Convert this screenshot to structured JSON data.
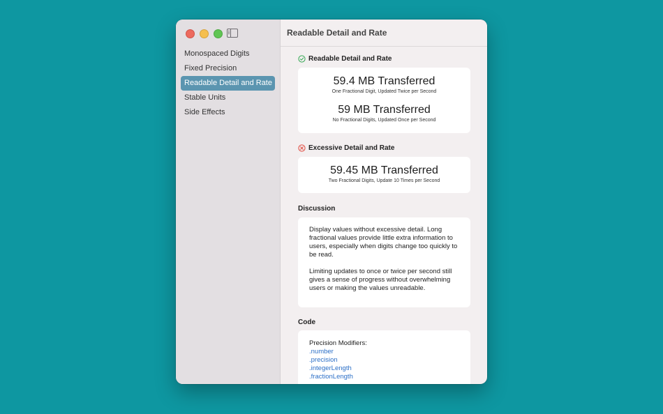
{
  "window": {
    "title": "Readable Detail and Rate"
  },
  "sidebar": {
    "items": [
      {
        "label": "Monospaced Digits"
      },
      {
        "label": "Fixed Precision"
      },
      {
        "label": "Readable Detail and Rate",
        "selected": true
      },
      {
        "label": "Stable Units"
      },
      {
        "label": "Side Effects"
      }
    ]
  },
  "readable": {
    "heading": "Readable Detail and Rate",
    "icon": "checkmark-circle-icon",
    "icon_color": "#34a853",
    "rows": [
      {
        "value": "59.4 MB Transferred",
        "caption": "One Fractional Digit, Updated Twice per Second"
      },
      {
        "value": "59 MB Transferred",
        "caption": "No Fractional Digits, Updated Once per Second"
      }
    ]
  },
  "excessive": {
    "heading": "Excessive Detail and Rate",
    "icon": "x-circle-icon",
    "icon_color": "#e0463b",
    "rows": [
      {
        "value": "59.45 MB Transferred",
        "caption": "Two Fractional Digits, Update 10 Times per Second"
      }
    ]
  },
  "discussion": {
    "heading": "Discussion",
    "paragraphs": [
      "Display values without excessive detail. Long fractional values provide little extra information to users, especially when digits change too quickly to be read.",
      "Limiting updates to once or twice per second still gives a sense of progress without overwhelming users or making the values unreadable."
    ]
  },
  "code": {
    "heading": "Code",
    "label": "Precision Modifiers:",
    "items": [
      ".number",
      ".precision",
      ".integerLength",
      ".fractionLength"
    ]
  },
  "colors": {
    "desktop": "#0e97a1",
    "sidebar_selection": "#5b95b0",
    "link": "#2b6fc7"
  }
}
